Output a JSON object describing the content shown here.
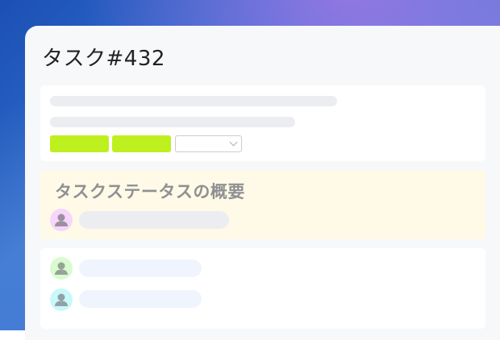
{
  "task": {
    "title": "タスク#432"
  },
  "summary": {
    "heading": "タスクステータスの概要"
  },
  "colors": {
    "accent_green": "#bef01f",
    "summary_bg": "#fefae7",
    "avatar_pink": "#f6d6fb",
    "avatar_green": "#d8fbcf",
    "avatar_cyan": "#c9f8fb"
  },
  "icons": {
    "avatar": "user-icon",
    "dropdown": "chevron-down-icon"
  }
}
